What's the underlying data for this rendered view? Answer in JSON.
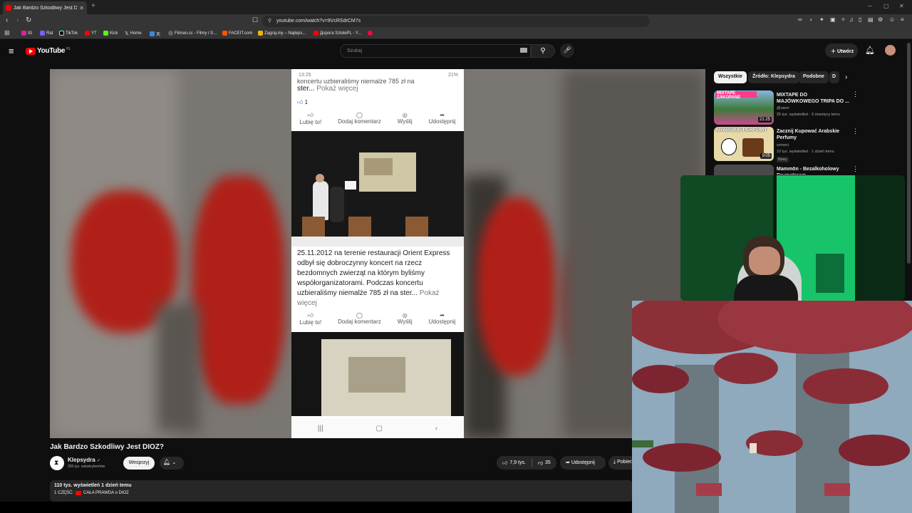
{
  "browser": {
    "tab_title": "Jak Bardzo Szkodliwy Jest DIOZ",
    "new_tab": "+",
    "url": "youtube.com/watch?v=9VcRSdrCM7s",
    "bookmarks": [
      {
        "label": "IG",
        "color": "#d6249f"
      },
      {
        "label": "Rat",
        "color": "#7b5cff"
      },
      {
        "label": "TikTok",
        "color": "#000000"
      },
      {
        "label": "YT",
        "color": "#ff0000"
      },
      {
        "label": "Kick",
        "color": "#53fc18"
      },
      {
        "label": "Home",
        "color": "#ffffff"
      },
      {
        "label": "天",
        "color": "#3a8be0"
      },
      {
        "label": "Filman.cc - Filmy i S...",
        "color": "#888888"
      },
      {
        "label": "FACEIT.com",
        "color": "#ff5500"
      },
      {
        "label": "Zagraj.my – Najleps...",
        "color": "#f0b400"
      },
      {
        "label": "Дорога SzlolePL - Y...",
        "color": "#ff0000"
      },
      {
        "label": "",
        "color": "#ff0044"
      }
    ]
  },
  "youtube": {
    "logo_text": "YouTube",
    "logo_region": "PL",
    "search_placeholder": "Szukaj",
    "create_label": "Utwórz"
  },
  "phone": {
    "status_time": "13:25",
    "status_right": "21%",
    "post1_tail": "koncertu uzbieraliśmy niemalże 785 zł na",
    "post1_line2": "ster...",
    "show_more": "Pokaż więcej",
    "reaction_count": "1",
    "actions": [
      "Lubię to!",
      "Dodaj komentarz",
      "Wyślij",
      "Udostępnij"
    ],
    "post2_text": "25.11.2012 na terenie restauracji Orient Express odbył się dobroczynny koncert na rzecz bezdomnych zwierząt na którym byliśmy współorganizatorami. Podczas koncertu uzbieraliśmy niemalże 785 zł na",
    "post2_line_end": "ster..."
  },
  "video": {
    "title": "Jak Bardzo Szkodliwy Jest DIOZ?",
    "channel": "Klepsydra",
    "subscribers": "250 tys. subskrybentów",
    "support_label": "Wesprzyj",
    "likes": "7,9 tys.",
    "dislikes": "35",
    "share_label": "Udostępnij",
    "download_label": "Pobierz",
    "views_line": "110 tys. wyświetleń  1 dzień temu",
    "desc_prefix": "1 CZĘŚĆ:",
    "desc_link": "CAŁA PRAWDA o DIOZ"
  },
  "chips": [
    "Wszystkie",
    "Źródło: Klepsydra",
    "Podobne",
    "D"
  ],
  "recommendations": [
    {
      "title": "MIXTAPE DO MAJÓWKOWEGO TRIPA DO ...",
      "channel": "@usen",
      "meta": "25 tys. wyświetleń · 6 miesięcy temu",
      "duration": "21:25",
      "thumb_text": "MIXTAPE ZAKOPANE",
      "badge": ""
    },
    {
      "title": "Zacznij Kupować Arabskie Perfumy",
      "channel": "szmeci",
      "meta": "10 tys. wyświetleń · 1 dzień temu",
      "duration": "9:05",
      "thumb_text": "ARABSKIE PERFUMY",
      "badge": "Nowy"
    },
    {
      "title": "Mammōn - Bezalkoholowy Drumstream",
      "channel": "",
      "meta": "",
      "duration": "",
      "thumb_text": "",
      "badge": ""
    }
  ],
  "colors": {
    "youtube_red": "#ff0000",
    "background": "#0f0f0f",
    "chip_bg": "#272727",
    "webcam_green": "#18c46a"
  }
}
